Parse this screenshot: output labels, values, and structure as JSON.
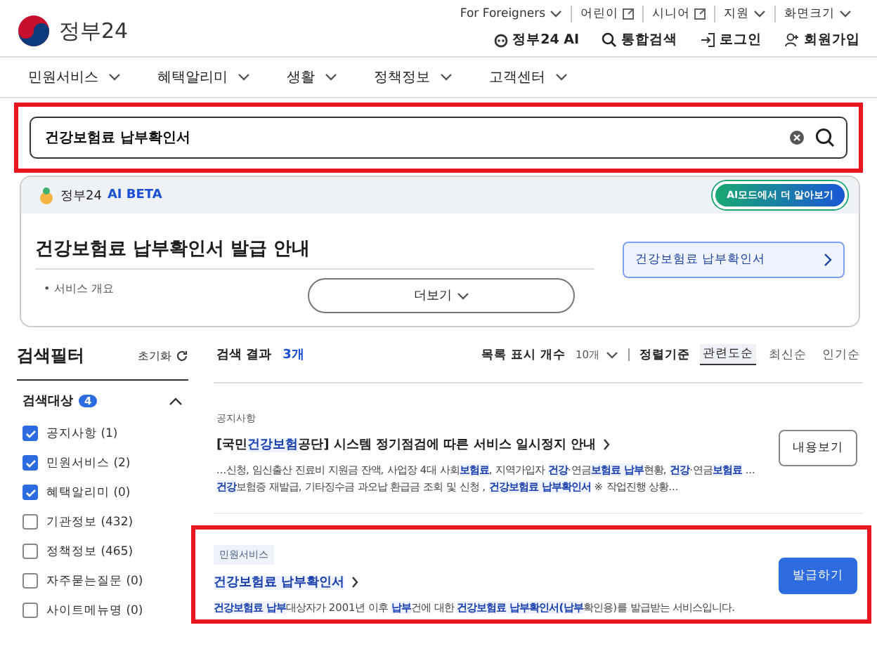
{
  "header": {
    "logo_text": "정부24",
    "util_links": [
      {
        "label": "For Foreigners",
        "kind": "dropdown"
      },
      {
        "label": "어린이",
        "kind": "external"
      },
      {
        "label": "시니어",
        "kind": "external"
      },
      {
        "label": "지원",
        "kind": "dropdown"
      },
      {
        "label": "화면크기",
        "kind": "dropdown"
      }
    ],
    "actions": [
      {
        "label": "정부24 AI",
        "kind": "ai"
      },
      {
        "label": "통합검색",
        "kind": "search"
      },
      {
        "label": "로그인",
        "kind": "login"
      },
      {
        "label": "회원가입",
        "kind": "join"
      }
    ]
  },
  "nav": [
    "민원서비스",
    "혜택알리미",
    "생활",
    "정책정보",
    "고객센터"
  ],
  "search": {
    "value": "건강보험료 납부확인서"
  },
  "ai_panel": {
    "brand": "정부24",
    "badge": "AI BETA",
    "more_button": "AI모드에서 더 알아보기",
    "title": "건강보험료 납부확인서 발급 안내",
    "link": "건강보험료 납부확인서",
    "bullet": "• 서비스 개요",
    "expand_button": "더보기"
  },
  "filter": {
    "title": "검색필터",
    "reset": "초기화",
    "group": "검색대상",
    "count": "4",
    "expanded": true,
    "items": [
      {
        "label": "공지사항 (1)",
        "checked": true
      },
      {
        "label": "민원서비스 (2)",
        "checked": true
      },
      {
        "label": "혜택알리미 (0)",
        "checked": true
      },
      {
        "label": "기관정보 (432)",
        "checked": false
      },
      {
        "label": "정책정보 (465)",
        "checked": false
      },
      {
        "label": "자주묻는질문 (0)",
        "checked": false
      },
      {
        "label": "사이트메뉴명 (0)",
        "checked": false
      }
    ]
  },
  "results": {
    "label": "검색 결과",
    "count": "3개",
    "page_size_label": "목록 표시 개수",
    "page_size": "10개",
    "sort_label": "정렬기준",
    "sorts": [
      {
        "label": "관련도순",
        "selected": true
      },
      {
        "label": "최신순",
        "selected": false
      },
      {
        "label": "인기순",
        "selected": false
      }
    ],
    "items": [
      {
        "category": "공지사항",
        "kind": "notice",
        "title": "[국민**건강보험**공단] 시스템 정기점검에 따른 서비스 일시정지 안내",
        "desc": "...신청, 임신출산 진료비 지원금 잔액, 사업장 4대 사회**보험료**, 지역가입자 **건강**·연금**보험료 납부**현황, **건강**·연금**보험료** ... **건강**보험증 재발급, 기타징수금 과오납 환급금 조회 및 신청 , **건강보험료 납부확인서** ※ 작업진행 상황...",
        "button": "내용보기",
        "highlighted": false
      },
      {
        "category": "민원서비스",
        "kind": "service",
        "title": "**건강보험료 납부확인서**",
        "desc": "**건강보험료 납부**대상자가 2001년 이후 **납부**건에 대한 **건강보험료 납부확인서(납부**확인용)를 발급받는 서비스입니다.",
        "button": "발급하기",
        "highlighted": true
      }
    ]
  }
}
